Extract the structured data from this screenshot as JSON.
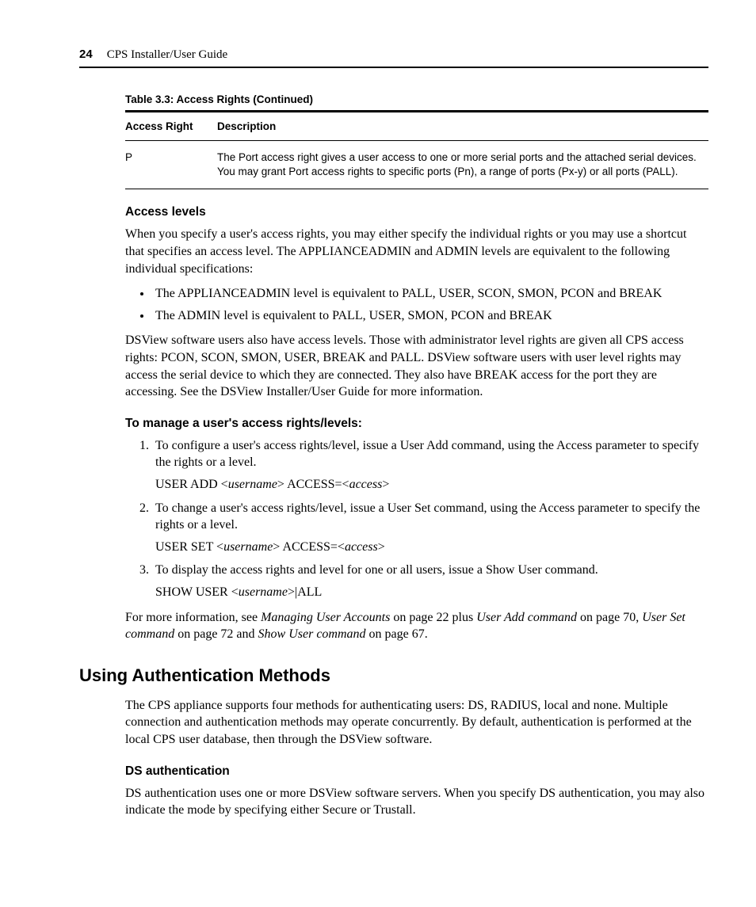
{
  "header": {
    "page_number": "24",
    "doc_title": "CPS Installer/User Guide"
  },
  "table": {
    "caption": "Table 3.3: Access Rights (Continued)",
    "head_col1": "Access Right",
    "head_col2": "Description",
    "row_right": "P",
    "row_desc": "The Port access right gives a user access to one or more serial ports and the attached serial devices. You may grant Port access rights to specific ports (Pn), a range of ports (Px-y) or all ports (PALL)."
  },
  "access_levels": {
    "heading": "Access levels",
    "intro": "When you specify a user's access rights, you may either specify the individual rights or you may use a shortcut that specifies an access level. The APPLIANCEADMIN and ADMIN levels are equivalent to the following individual specifications:",
    "bullet1": "The APPLIANCEADMIN level is equivalent to PALL, USER, SCON, SMON, PCON and BREAK",
    "bullet2": "The ADMIN level is equivalent to PALL, USER, SMON, PCON and BREAK",
    "dsview": "DSView software users also have access levels. Those with administrator level rights are given all CPS access rights: PCON, SCON, SMON, USER, BREAK and PALL. DSView software users with user level rights may access the serial device to which they are connected. They also have BREAK access for the port they are accessing. See the DSView Installer/User Guide for more information."
  },
  "manage": {
    "heading": "To manage a user's access rights/levels:",
    "step1": "To configure a user's access rights/level, issue a User Add command, using the Access parameter to specify the rights or a level.",
    "cmd1_a": "USER ADD <",
    "cmd1_b": "username",
    "cmd1_c": "> ACCESS=<",
    "cmd1_d": "access",
    "cmd1_e": ">",
    "step2": "To change a user's access rights/level, issue a User Set command, using the Access parameter to specify the rights or a level.",
    "cmd2_a": "USER SET <",
    "cmd2_b": "username",
    "cmd2_c": "> ACCESS=<",
    "cmd2_d": "access",
    "cmd2_e": ">",
    "step3": "To display the access rights and level for one or all users, issue a Show User command.",
    "cmd3_a": "SHOW USER <",
    "cmd3_b": "username",
    "cmd3_c": ">|ALL",
    "more_a": "For more information, see ",
    "more_b": "Managing User Accounts",
    "more_c": " on page 22 plus ",
    "more_d": "User Add command",
    "more_e": " on page 70, ",
    "more_f": "User Set command",
    "more_g": " on page 72 and ",
    "more_h": "Show User command",
    "more_i": " on page 67."
  },
  "auth": {
    "heading": "Using Authentication Methods",
    "intro": "The CPS appliance supports four methods for authenticating users: DS, RADIUS, local and none. Multiple connection and authentication methods may operate concurrently. By default, authentication is performed at the local CPS user database, then through the DSView software.",
    "ds_heading": "DS authentication",
    "ds_body": "DS authentication uses one or more DSView software servers. When you specify DS authentication, you may also indicate the mode by specifying either Secure or Trustall."
  }
}
